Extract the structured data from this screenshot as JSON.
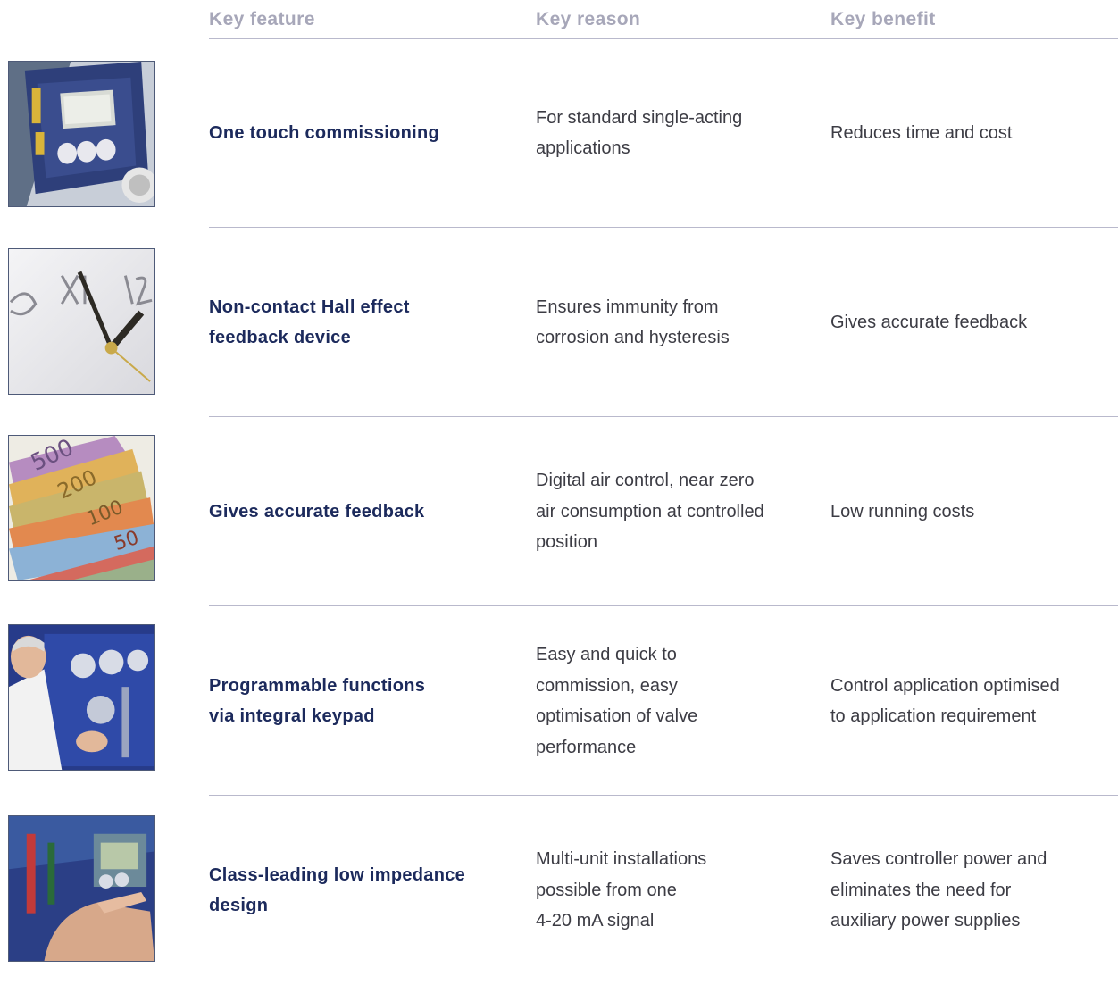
{
  "headers": {
    "feature": "Key feature",
    "reason": "Key reason",
    "benefit": "Key benefit"
  },
  "rows": [
    {
      "image": "positioner-keypad-photo",
      "feature": "One touch commissioning",
      "reason": "For standard single-acting\napplications",
      "benefit": "Reduces time and cost"
    },
    {
      "image": "clock-face-photo",
      "feature": "Non-contact Hall effect\nfeedback device",
      "reason": "Ensures immunity from\ncorrosion and hysteresis",
      "benefit": "Gives accurate feedback"
    },
    {
      "image": "euro-banknotes-photo",
      "feature": "Gives accurate feedback",
      "reason": "Digital air control, near zero\nair consumption at controlled\nposition",
      "benefit": "Low running costs"
    },
    {
      "image": "technician-panel-photo",
      "feature": "Programmable functions\nvia integral keypad",
      "reason": "Easy and quick to\ncommission, easy\noptimisation of valve\nperformance",
      "benefit": "Control application optimised\nto application requirement"
    },
    {
      "image": "hand-pressing-keypad-photo",
      "feature": "Class-leading low impedance\ndesign",
      "reason": "Multi-unit installations\npossible from one\n4-20 mA signal",
      "benefit": "Saves controller power and\neliminates the need for\nauxiliary power supplies"
    }
  ],
  "colors": {
    "header_text": "#a7a7b9",
    "feature_text": "#1c2a5c",
    "body_text": "#3c3c44",
    "divider": "#b9b9cc"
  }
}
